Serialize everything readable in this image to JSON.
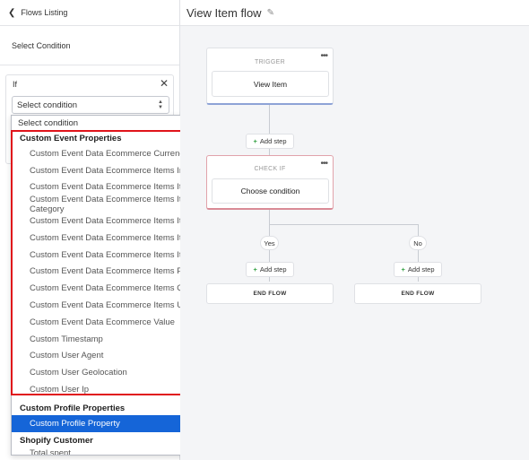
{
  "header": {
    "back_label": "Flows Listing",
    "flow_title": "View Item flow"
  },
  "panel": {
    "section_title": "Select Condition",
    "if_label": "If",
    "select_value": "Select condition"
  },
  "dropdown": {
    "placeholder": "Select condition",
    "groups": [
      {
        "label": "Custom Event Properties",
        "options": [
          "Custom Event Data Ecommerce Currency",
          "Custom Event Data Ecommerce Items Image Url",
          "Custom Event Data Ecommerce Items Item Brand",
          "Custom Event Data Ecommerce Items Item Category",
          "Custom Event Data Ecommerce Items Item Id",
          "Custom Event Data Ecommerce Items Item Name",
          "Custom Event Data Ecommerce Items Item Variant",
          "Custom Event Data Ecommerce Items Price",
          "Custom Event Data Ecommerce Items Quantity",
          "Custom Event Data Ecommerce Items Url",
          "Custom Event Data Ecommerce Value",
          "Custom Timestamp",
          "Custom User Agent",
          "Custom User Geolocation",
          "Custom User Ip"
        ]
      },
      {
        "label": "Custom Profile Properties",
        "options": [
          "Custom Profile Property"
        ]
      },
      {
        "label": "Shopify Customer",
        "options": [
          "Total spent"
        ]
      }
    ],
    "selected_option": "Custom Profile Property"
  },
  "flow": {
    "trigger_header": "TRIGGER",
    "trigger_value": "View Item",
    "add_step": "Add step",
    "checkif_header": "CHECK IF",
    "checkif_value": "Choose condition",
    "yes_label": "Yes",
    "no_label": "No",
    "end_flow": "END FLOW"
  },
  "colors": {
    "accent": "#1565d8",
    "highlight": "#e0141b",
    "add_plus": "#2e9e3e"
  },
  "icons": [
    "chevron-left-icon",
    "close-icon",
    "select-arrows-icon",
    "pencil-icon",
    "more-options-icon",
    "plus-icon"
  ]
}
